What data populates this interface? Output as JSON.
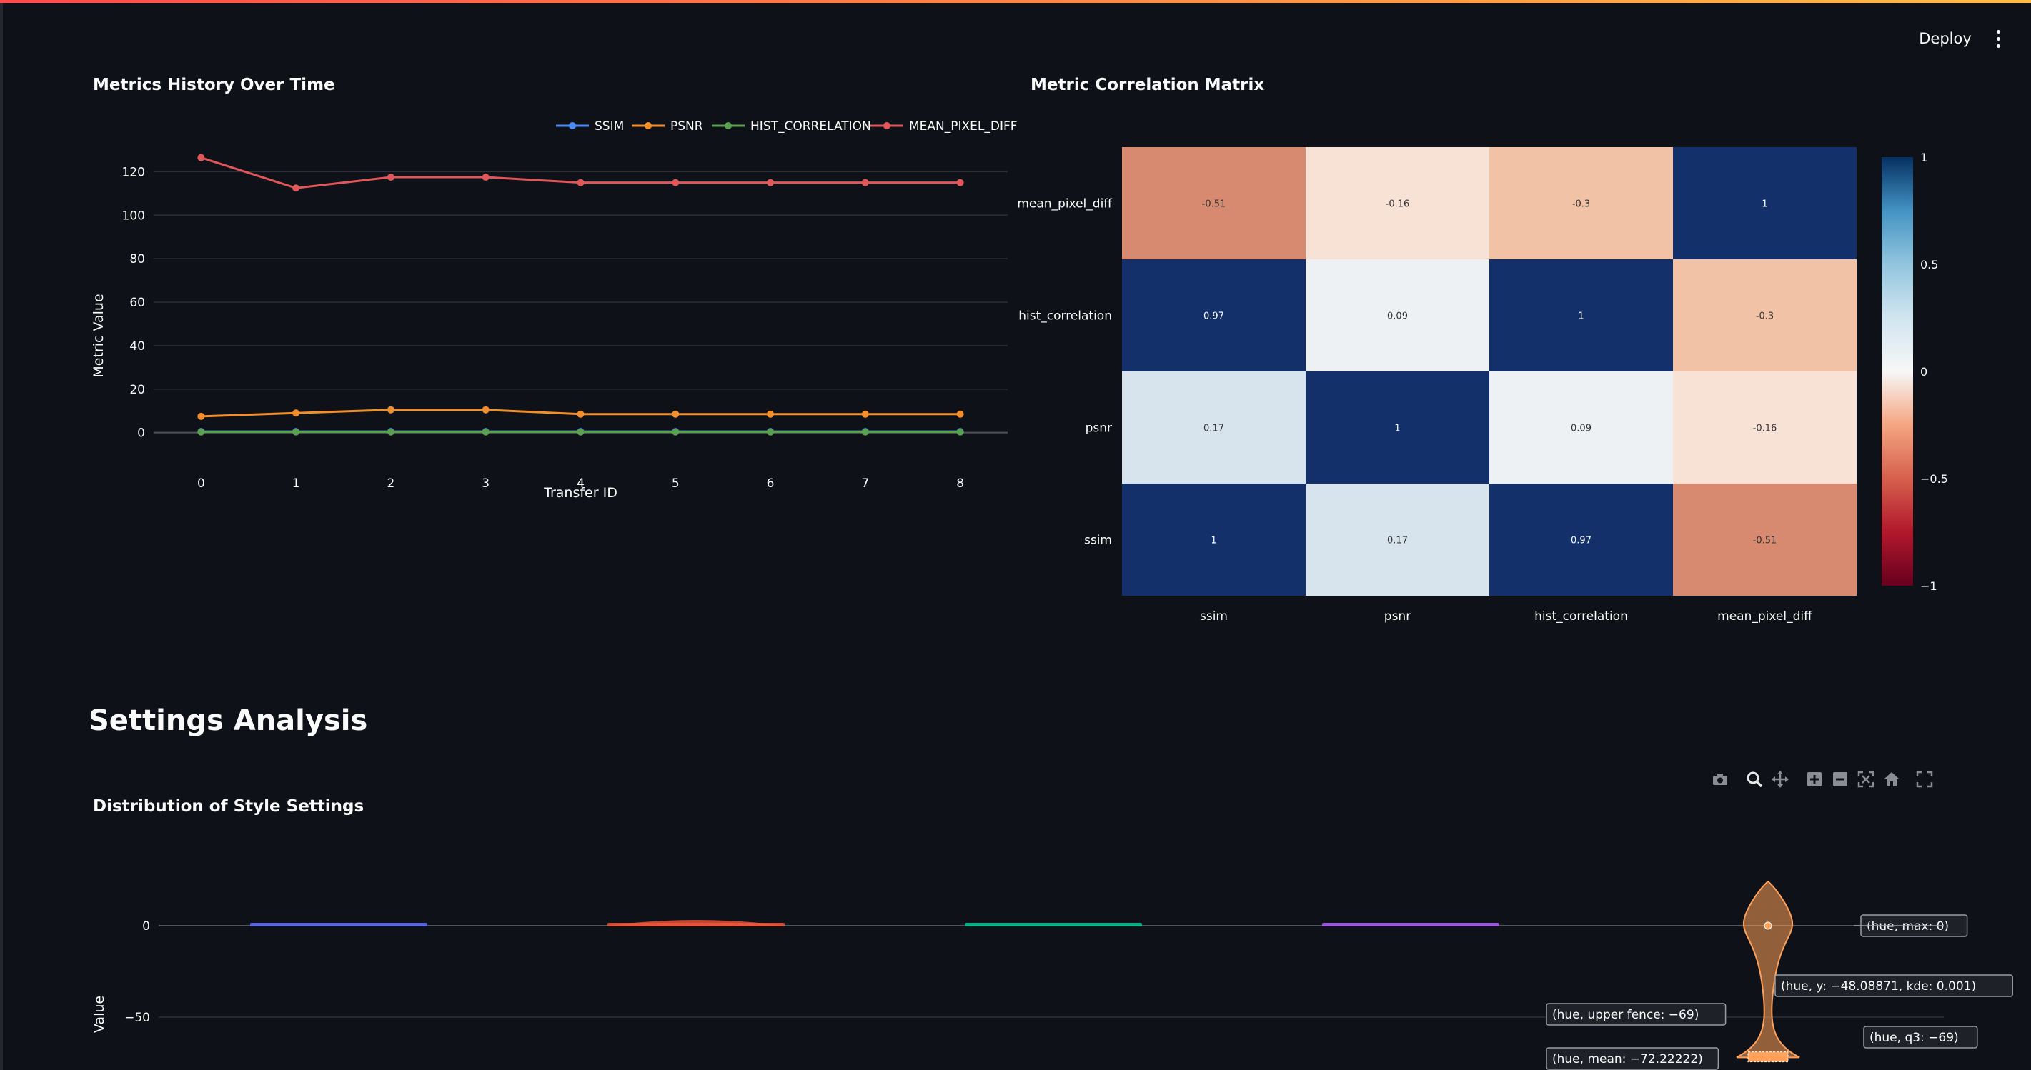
{
  "header": {
    "deploy_label": "Deploy",
    "menu_icon": "more-vertical-icon"
  },
  "metrics_chart": {
    "title": "Metrics History Over Time",
    "chart_data": {
      "type": "line",
      "x": [
        0,
        1,
        2,
        3,
        4,
        5,
        6,
        7,
        8
      ],
      "xlabel": "Transfer ID",
      "ylabel": "Metric Value",
      "ylim": [
        -8,
        130
      ],
      "yticks": [
        0,
        20,
        40,
        60,
        80,
        100,
        120
      ],
      "legend_placement": "top-right",
      "grid": true,
      "series": [
        {
          "name": "SSIM",
          "color": "#4c8bf5",
          "values": [
            0.5,
            0.5,
            0.5,
            0.5,
            0.5,
            0.5,
            0.5,
            0.5,
            0.5
          ]
        },
        {
          "name": "PSNR",
          "color": "#f28e2b",
          "values": [
            7.5,
            9.0,
            10.5,
            10.5,
            8.5,
            8.5,
            8.5,
            8.5,
            8.5
          ]
        },
        {
          "name": "HIST_CORRELATION",
          "color": "#59a14f",
          "values": [
            0.3,
            0.3,
            0.3,
            0.3,
            0.3,
            0.3,
            0.3,
            0.3,
            0.3
          ]
        },
        {
          "name": "MEAN_PIXEL_DIFF",
          "color": "#e15759",
          "values": [
            126.5,
            112.5,
            117.5,
            117.5,
            115,
            115,
            115,
            115,
            115
          ]
        }
      ]
    }
  },
  "correlation_chart": {
    "title": "Metric Correlation Matrix",
    "chart_data": {
      "type": "heatmap",
      "x": [
        "ssim",
        "psnr",
        "hist_correlation",
        "mean_pixel_diff"
      ],
      "y": [
        "mean_pixel_diff",
        "hist_correlation",
        "psnr",
        "ssim"
      ],
      "values": [
        [
          -0.51,
          -0.16,
          -0.3,
          1
        ],
        [
          0.97,
          0.09,
          1,
          -0.3
        ],
        [
          0.17,
          1,
          0.09,
          -0.16
        ],
        [
          1,
          0.17,
          0.97,
          -0.51
        ]
      ],
      "zlim": [
        -1,
        1
      ],
      "colorbar_ticks": [
        1,
        0.5,
        0,
        -0.5,
        -1
      ],
      "colorbar_labels": [
        "1",
        "0.5",
        "0",
        "−0.5",
        "−1"
      ],
      "colorscale": "RdBu"
    }
  },
  "section": {
    "heading": "Settings Analysis"
  },
  "distribution_chart": {
    "title": "Distribution of Style Settings",
    "modebar": [
      "camera-icon",
      "zoom-icon",
      "pan-icon",
      "zoom-in-icon",
      "zoom-out-icon",
      "autoscale-icon",
      "reset-axes-icon",
      "fullscreen-icon"
    ],
    "chart_data": {
      "type": "violin",
      "ylabel": "Value",
      "yticks": [
        0,
        -50
      ],
      "ytick_labels": [
        "0",
        "−50"
      ],
      "series": [
        {
          "color": "#636efa",
          "center": 0.5,
          "half_width": 0.5
        },
        {
          "color": "#ef553b",
          "center": 0.5,
          "half_width": 0.5
        },
        {
          "color": "#00cc96",
          "center": 0.5,
          "half_width": 0.5
        },
        {
          "color": "#ab63fa",
          "center": 0.5,
          "half_width": 0.5
        },
        {
          "color": "#ffa15a",
          "name": "hue",
          "max": 0,
          "q3": -69,
          "upper_fence": -69,
          "mean": -72.22222
        }
      ],
      "annotations": [
        "(hue, max: 0)",
        "(hue, y: −48.08871, kde: 0.001)",
        "(hue, upper fence: −69)",
        "(hue, q3: −69)",
        "(hue, mean: −72.22222)"
      ]
    }
  }
}
